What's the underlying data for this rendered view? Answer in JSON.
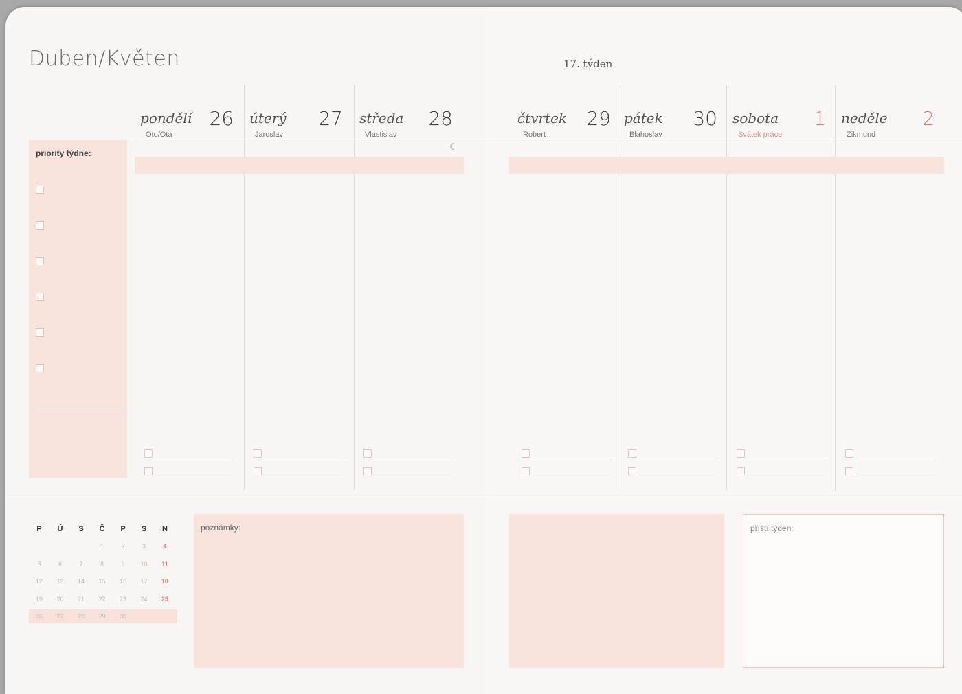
{
  "header": {
    "month_title": "Duben/Květen",
    "week_label": "17. týden"
  },
  "days": [
    {
      "name": "pondělí",
      "number": "26",
      "nameday": "Oto/Ota",
      "holiday": false
    },
    {
      "name": "úterý",
      "number": "27",
      "nameday": "Jaroslav",
      "holiday": false
    },
    {
      "name": "středa",
      "number": "28",
      "nameday": "Vlastislav",
      "holiday": false
    },
    {
      "name": "čtvrtek",
      "number": "29",
      "nameday": "Robert",
      "holiday": false
    },
    {
      "name": "pátek",
      "number": "30",
      "nameday": "Blahoslav",
      "holiday": false
    },
    {
      "name": "sobota",
      "number": "1",
      "nameday": "Svátek práce",
      "holiday": true
    },
    {
      "name": "neděle",
      "number": "2",
      "nameday": "Zikmund",
      "holiday": true
    }
  ],
  "priorities": {
    "title": "priority týdne:"
  },
  "moon_icon": "☾",
  "mini_calendar": {
    "headers": [
      "P",
      "Ú",
      "S",
      "Č",
      "P",
      "S",
      "N"
    ],
    "weeks": [
      [
        "",
        "",
        "",
        "1",
        "2",
        "3",
        "4"
      ],
      [
        "5",
        "6",
        "7",
        "8",
        "9",
        "10",
        "11"
      ],
      [
        "12",
        "13",
        "14",
        "15",
        "16",
        "17",
        "18"
      ],
      [
        "19",
        "20",
        "21",
        "22",
        "23",
        "24",
        "25"
      ],
      [
        "26",
        "27",
        "28",
        "29",
        "30",
        "",
        ""
      ]
    ]
  },
  "notes": {
    "label": "poznámky:"
  },
  "next_week": {
    "label": "příští týden:"
  },
  "colors": {
    "pink": "#f8e3dd",
    "accent_red": "#e07b7b"
  }
}
